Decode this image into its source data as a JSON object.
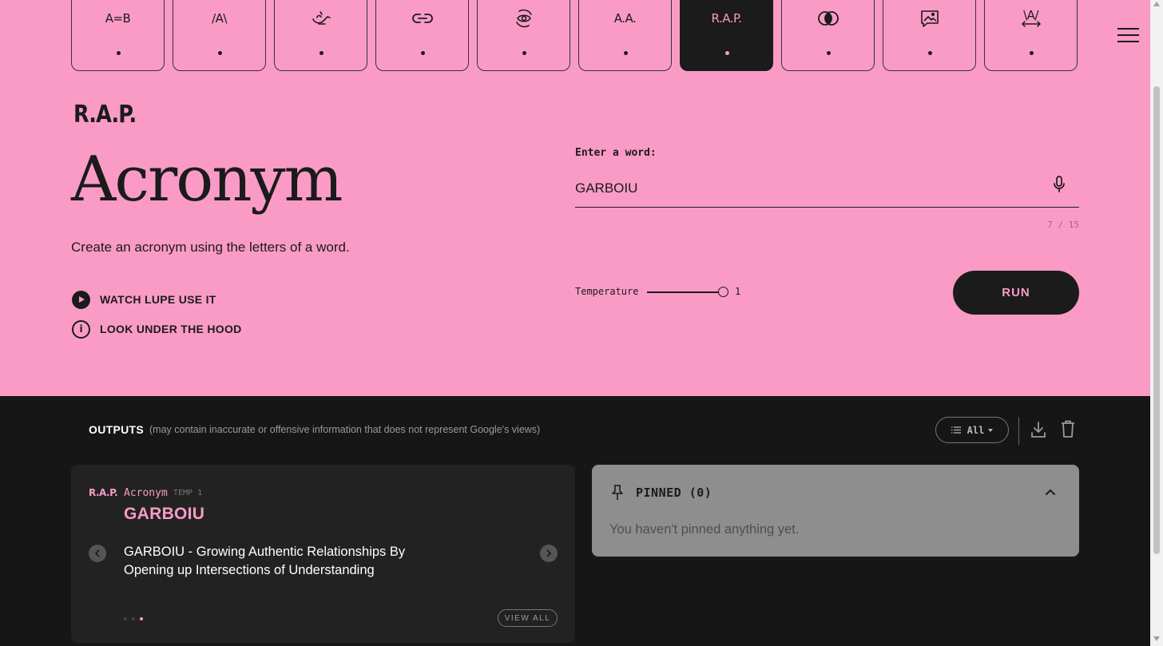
{
  "tools": [
    {
      "name": "same-different",
      "icon": "A=B",
      "active": false
    },
    {
      "name": "unexpect",
      "icon": "/A\\",
      "active": false
    },
    {
      "name": "semantic-transfer",
      "icon": "magic-lamp-icon",
      "active": false
    },
    {
      "name": "chain",
      "icon": "link-icon",
      "active": false
    },
    {
      "name": "pov",
      "icon": "eye-rotate-icon",
      "active": false
    },
    {
      "name": "alliteration",
      "icon": "A.A.",
      "active": false
    },
    {
      "name": "acronym",
      "icon": "R.A.P.",
      "active": true
    },
    {
      "name": "intersection",
      "icon": "overlap-circles-icon",
      "active": false
    },
    {
      "name": "scene",
      "icon": "image-frame-icon",
      "active": false
    },
    {
      "name": "unfold",
      "icon": "\\A/",
      "active": false
    }
  ],
  "header": {
    "tool_logo": "R.A.P.",
    "tool_title": "Acronym",
    "tool_description": "Create an acronym using the letters of a word.",
    "watch_label": "WATCH LUPE USE IT",
    "hood_label": "LOOK UNDER THE HOOD"
  },
  "input": {
    "label": "Enter a word:",
    "value": "GARBOIU",
    "char_count": "7 / 15",
    "temperature_label": "Temperature",
    "temperature_value": "1",
    "temperature_fraction": 1.0,
    "run_label": "RUN"
  },
  "outputs": {
    "title": "OUTPUTS",
    "note": "(may contain inaccurate or offensive information that does not represent Google's views)",
    "filter_label": "All",
    "result": {
      "logo": "R.A.P.",
      "tool": "Acronym",
      "temp": "TEMP 1",
      "word": "GARBOIU",
      "text": "GARBOIU - Growing Authentic Relationships By Opening up Intersections of Understanding",
      "view_all_label": "VIEW ALL",
      "carousel_pages": 3,
      "carousel_active": 3
    },
    "pinned": {
      "title": "PINNED (0)",
      "empty_text": "You haven't pinned anything yet."
    }
  },
  "colors": {
    "accent_pink": "#fa9bc6",
    "dark": "#1b1b1b",
    "outputs_bg": "#161616"
  }
}
